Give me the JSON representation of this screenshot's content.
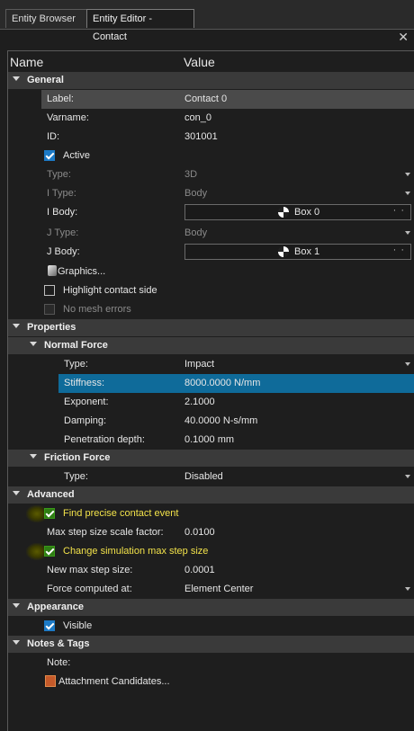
{
  "tabs": [
    {
      "label": "Entity Browser"
    },
    {
      "label": "Entity Editor - Contact"
    }
  ],
  "header": {
    "name": "Name",
    "value": "Value"
  },
  "icons": {
    "close": "close-icon",
    "expand": "chevron-down-icon",
    "dropdown": "dropdown-arrow-icon",
    "body": "body-icon",
    "graphics": "graphics-icon",
    "attachment": "attachment-icon"
  },
  "colors": {
    "selection_blue": "#0f6b9a",
    "highlight_yellow": "#f2e24a",
    "check_blue": "#1c7ac6",
    "check_green": "#2f7d14"
  },
  "general": {
    "title": "General",
    "label_name": "Label:",
    "label_value": "Contact 0",
    "varname_name": "Varname:",
    "varname_value": "con_0",
    "id_name": "ID:",
    "id_value": "301001",
    "active": "Active",
    "type_name": "Type:",
    "type_value": "3D",
    "itype_name": "I Type:",
    "itype_value": "Body",
    "ibody_name": "I Body:",
    "ibody_value": "Box 0",
    "jtype_name": "J Type:",
    "jtype_value": "Body",
    "jbody_name": "J Body:",
    "jbody_value": "Box 1",
    "graphics": "Graphics...",
    "highlight": "Highlight contact side",
    "nomesh": "No mesh errors",
    "dots": "· ·"
  },
  "properties": {
    "title": "Properties",
    "normal_title": "Normal Force",
    "nf_type_name": "Type:",
    "nf_type_value": "Impact",
    "stiffness_name": "Stiffness:",
    "stiffness_value": "8000.0000 N/mm",
    "exponent_name": "Exponent:",
    "exponent_value": "2.1000",
    "damping_name": "Damping:",
    "damping_value": "40.0000 N-s/mm",
    "pen_name": "Penetration depth:",
    "pen_value": "0.1000 mm",
    "friction_title": "Friction Force",
    "ff_type_name": "Type:",
    "ff_type_value": "Disabled"
  },
  "advanced": {
    "title": "Advanced",
    "precise": "Find precise contact event",
    "maxstep_name": "Max step size scale factor:",
    "maxstep_value": "0.0100",
    "change": "Change simulation max step size",
    "newmax_name": "New max step size:",
    "newmax_value": "0.0001",
    "force_name": "Force computed at:",
    "force_value": "Element Center"
  },
  "appearance": {
    "title": "Appearance",
    "visible": "Visible"
  },
  "notes": {
    "title": "Notes & Tags",
    "note": "Note:",
    "attach": "Attachment Candidates..."
  }
}
